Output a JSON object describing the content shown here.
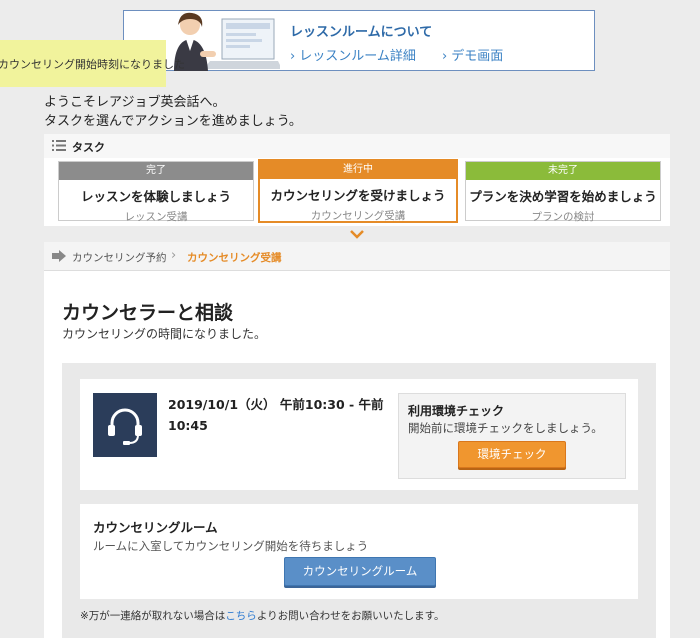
{
  "banner": {
    "title": "レッスンルームについて",
    "link1": "レッスンルーム詳細",
    "link2": "デモ画面"
  },
  "notice": {
    "text": "カウンセリング開始時刻になりました"
  },
  "welcome": {
    "line1": "ようこそレアジョブ英会話へ。",
    "line2": "タスクを選んでアクションを進めましょう。"
  },
  "tasks": {
    "header": "タスク",
    "items": [
      {
        "status": "完了",
        "title": "レッスンを体験しましょう",
        "sub": "レッスン受講"
      },
      {
        "status": "進行中",
        "title": "カウンセリングを受けましょう",
        "sub": "カウンセリング受講"
      },
      {
        "status": "未完了",
        "title": "プランを決め学習を始めましょう",
        "sub": "プランの検討"
      }
    ]
  },
  "breadcrumb": {
    "step1": "カウンセリング予約",
    "step2": "カウンセリング受講"
  },
  "main": {
    "title": "カウンセラーと相談",
    "subtitle": "カウンセリングの時間になりました。",
    "datetime": "2019/10/1（火） 午前10:30 - 午前10:45",
    "env": {
      "title": "利用環境チェック",
      "text": "開始前に環境チェックをしましょう。",
      "button": "環境チェック"
    },
    "room": {
      "title": "カウンセリングルーム",
      "text": "ルームに入室してカウンセリング開始を待ちましょう",
      "button": "カウンセリングルーム"
    },
    "footnote": {
      "prefix": "※万が一連絡が取れない場合は",
      "link": "こちら",
      "suffix": "よりお問い合わせをお願いいたします。"
    }
  },
  "colors": {
    "accent_orange": "#e58b27",
    "done_gray": "#8c8c8c",
    "todo_green": "#8bbb3a",
    "link_blue": "#3b82c4",
    "room_button_blue": "#5a8fc8"
  }
}
